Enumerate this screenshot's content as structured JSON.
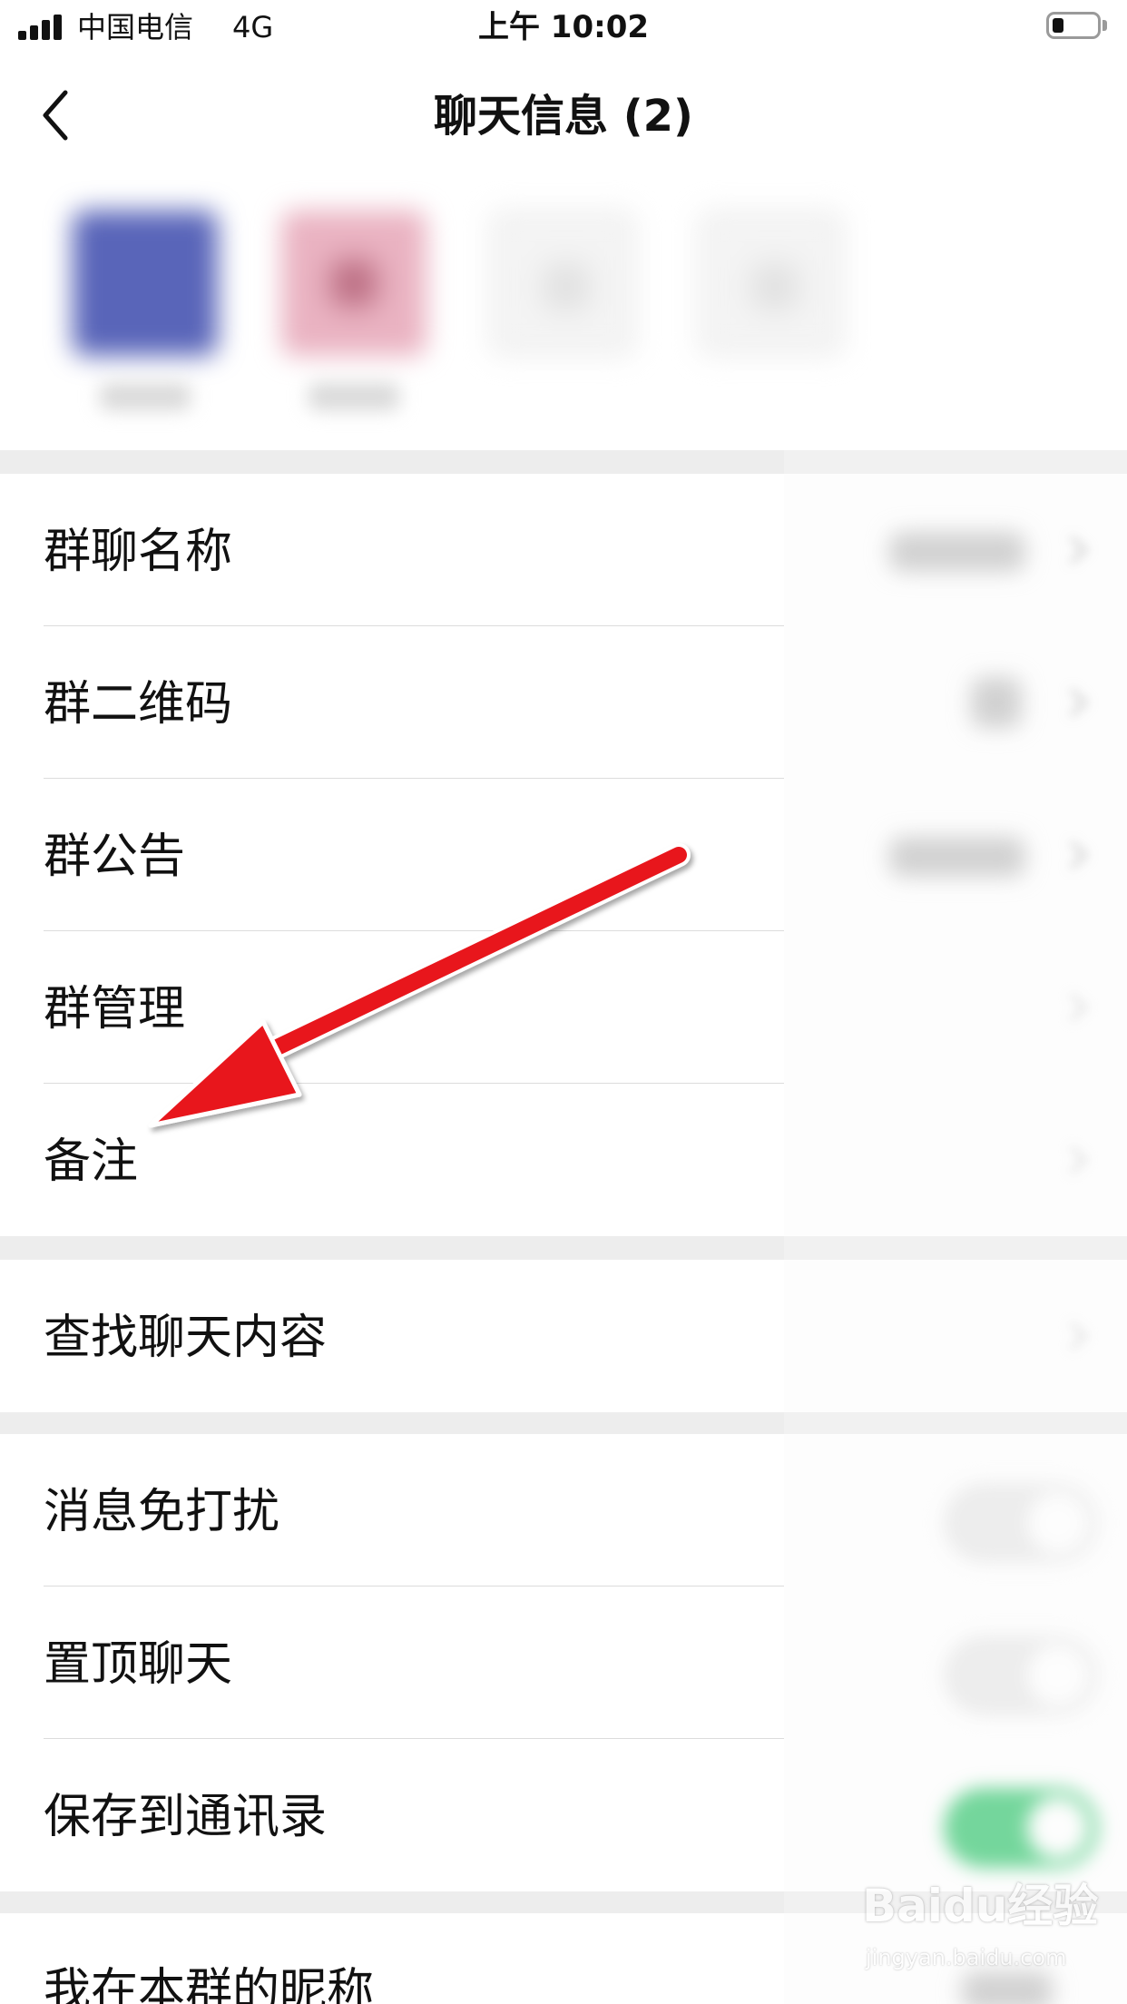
{
  "status_bar": {
    "carrier": "中国电信",
    "network": "4G",
    "time": "上午 10:02"
  },
  "header": {
    "title": "聊天信息 (2)",
    "back_icon": "chevron-left-icon"
  },
  "members": [
    {
      "avatar_color": "#5965b9"
    },
    {
      "avatar_color": "#e6a7b6"
    },
    {
      "avatar_color": "#f1f1f1"
    },
    {
      "avatar_color": "#f1f1f1"
    }
  ],
  "settings": {
    "group_1": [
      {
        "label": "群聊名称"
      },
      {
        "label": "群二维码"
      },
      {
        "label": "群公告"
      },
      {
        "label": "群管理"
      },
      {
        "label": "备注"
      }
    ],
    "group_2": [
      {
        "label": "查找聊天内容"
      }
    ],
    "group_3": [
      {
        "label": "消息免打扰",
        "toggle": "off"
      },
      {
        "label": "置顶聊天",
        "toggle": "off"
      },
      {
        "label": "保存到通讯录",
        "toggle": "on"
      }
    ],
    "group_4": [
      {
        "label": "我在本群的昵称"
      }
    ]
  },
  "colors": {
    "toggle_on": "#2dc46a",
    "annotation_arrow": "#e8141a",
    "page_background": "#ededed"
  },
  "watermark": {
    "brand": "Baidu经验",
    "url": "jingyan.baidu.com"
  }
}
